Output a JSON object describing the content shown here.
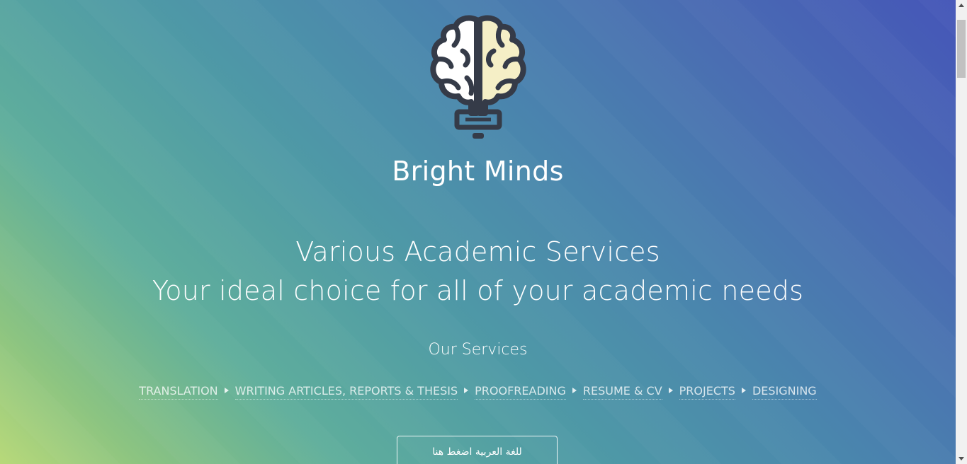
{
  "site": {
    "title": "Bright Minds",
    "tagline_line1": "Various Academic Services",
    "tagline_line2": "Your ideal choice for all of your academic needs"
  },
  "services": {
    "heading": "Our Services",
    "items": [
      {
        "label": "TRANSLATION"
      },
      {
        "label": "WRITING ARTICLES, REPORTS & THESIS"
      },
      {
        "label": "PROOFREADING"
      },
      {
        "label": "RESUME & CV"
      },
      {
        "label": "PROJECTS"
      },
      {
        "label": "DESIGNING"
      }
    ]
  },
  "language_button": {
    "label": "للغة العربية اضغط هنا"
  },
  "icons": {
    "logo": "brain-lightbulb-icon",
    "separator": "triangle-right-icon"
  },
  "colors": {
    "logo_outline": "#353b48",
    "logo_right_fill": "#f5efc6",
    "logo_left_fill": "#ffffff"
  }
}
